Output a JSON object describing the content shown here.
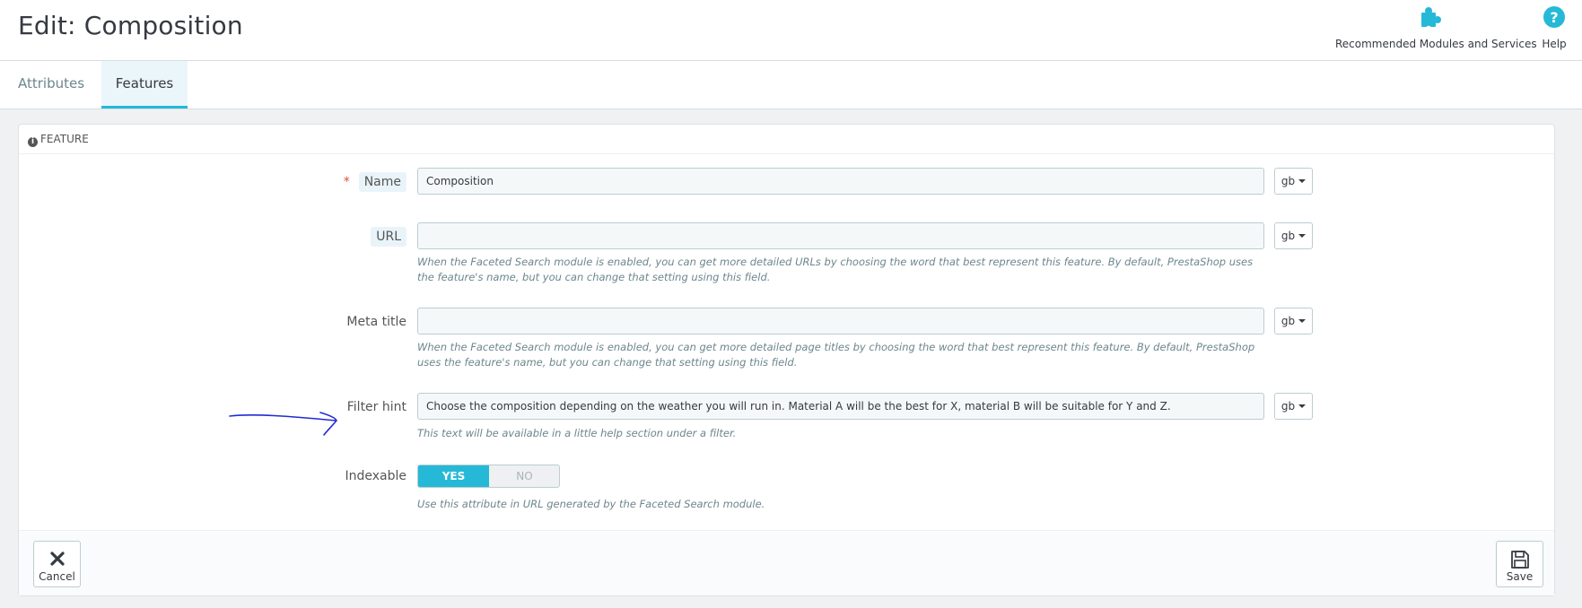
{
  "header": {
    "title": "Edit: Composition",
    "toolbar": [
      {
        "label": "Recommended Modules and Services",
        "icon": "puzzle-icon"
      },
      {
        "label": "Help",
        "icon": "help-icon"
      }
    ]
  },
  "tabs": [
    {
      "label": "Attributes",
      "active": false
    },
    {
      "label": "Features",
      "active": true
    }
  ],
  "panel": {
    "heading": "Feature",
    "fields": {
      "name": {
        "label": "Name",
        "required": true,
        "value": "Composition",
        "lang": "gb"
      },
      "url": {
        "label": "URL",
        "value": "",
        "lang": "gb",
        "help": "When the Faceted Search module is enabled, you can get more detailed URLs by choosing the word that best represent this feature. By default, PrestaShop uses the feature's name, but you can change that setting using this field."
      },
      "meta_title": {
        "label": "Meta title",
        "value": "",
        "lang": "gb",
        "help": "When the Faceted Search module is enabled, you can get more detailed page titles by choosing the word that best represent this feature. By default, PrestaShop uses the feature's name, but you can change that setting using this field."
      },
      "filter_hint": {
        "label": "Filter hint",
        "value": "Choose the composition depending on the weather you will run in. Material A will be the best for X, material B will be suitable for Y and Z.",
        "lang": "gb",
        "help": "This text will be available in a little help section under a filter."
      },
      "indexable": {
        "label": "Indexable",
        "yes": "YES",
        "no": "NO",
        "selected": "YES",
        "help": "Use this attribute in URL generated by the Faceted Search module."
      }
    },
    "footer": {
      "cancel": "Cancel",
      "save": "Save"
    }
  },
  "colors": {
    "accent": "#25b9d7",
    "required": "#e64a3b",
    "annotation": "#1f2bd6"
  }
}
